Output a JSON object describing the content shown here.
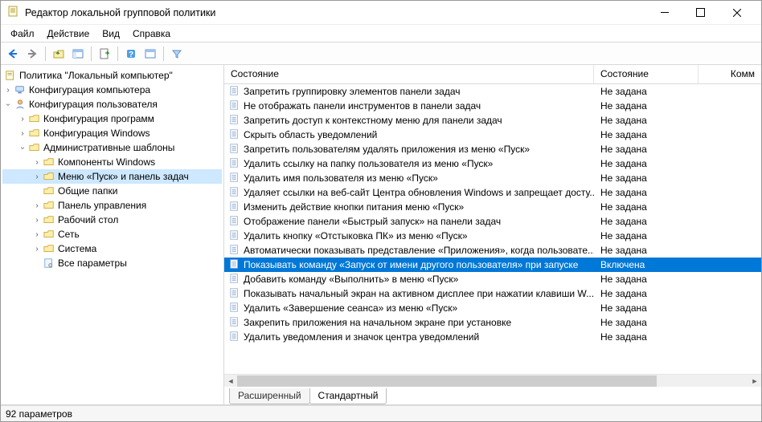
{
  "window": {
    "title": "Редактор локальной групповой политики"
  },
  "menu": [
    "Файл",
    "Действие",
    "Вид",
    "Справка"
  ],
  "tree": {
    "root": "Политика \"Локальный компьютер\"",
    "computer_cfg": "Конфигурация компьютера",
    "user_cfg": "Конфигурация пользователя",
    "prog_cfg": "Конфигурация программ",
    "win_cfg": "Конфигурация Windows",
    "admin_tpl": "Административные шаблоны",
    "comp_win": "Компоненты Windows",
    "start_taskbar": "Меню «Пуск» и панель задач",
    "shared": "Общие папки",
    "control_panel": "Панель управления",
    "desktop": "Рабочий стол",
    "network": "Сеть",
    "system": "Система",
    "all_params": "Все параметры"
  },
  "columns": {
    "c1": "Состояние",
    "c2": "Состояние",
    "c3": "Комм"
  },
  "col_widths": {
    "c1": 460,
    "c2": 130
  },
  "state_unset": "Не задана",
  "state_enabled": "Включена",
  "list": [
    {
      "name": "Запретить группировку элементов панели задач",
      "state_key": "unset"
    },
    {
      "name": "Не отображать панели инструментов в панели задач",
      "state_key": "unset"
    },
    {
      "name": "Запретить доступ к контекстному меню для панели задач",
      "state_key": "unset"
    },
    {
      "name": "Скрыть область уведомлений",
      "state_key": "unset"
    },
    {
      "name": "Запретить пользователям удалять приложения из меню «Пуск»",
      "state_key": "unset"
    },
    {
      "name": "Удалить ссылку на папку пользователя из меню «Пуск»",
      "state_key": "unset"
    },
    {
      "name": "Удалить имя пользователя из меню «Пуск»",
      "state_key": "unset"
    },
    {
      "name": "Удаляет ссылки на веб-сайт Центра обновления Windows и запрещает досту...",
      "state_key": "unset"
    },
    {
      "name": "Изменить действие кнопки питания меню «Пуск»",
      "state_key": "unset"
    },
    {
      "name": "Отображение панели «Быстрый запуск» на панели задач",
      "state_key": "unset"
    },
    {
      "name": "Удалить кнопку «Отстыковка ПК» из меню «Пуск»",
      "state_key": "unset"
    },
    {
      "name": "Автоматически показывать представление «Приложения», когда пользовате...",
      "state_key": "unset"
    },
    {
      "name": "Показывать команду «Запуск от имени другого пользователя» при запуске",
      "state_key": "enabled",
      "selected": true
    },
    {
      "name": "Добавить команду «Выполнить» в меню «Пуск»",
      "state_key": "unset"
    },
    {
      "name": "Показывать начальный экран на активном дисплее при нажатии клавиши W...",
      "state_key": "unset"
    },
    {
      "name": "Удалить «Завершение сеанса» из меню «Пуск»",
      "state_key": "unset"
    },
    {
      "name": "Закрепить приложения на начальном экране при установке",
      "state_key": "unset"
    },
    {
      "name": "Удалить уведомления и значок центра уведомлений",
      "state_key": "unset"
    }
  ],
  "tabs": {
    "extended": "Расширенный",
    "standard": "Стандартный"
  },
  "status": "92 параметров"
}
